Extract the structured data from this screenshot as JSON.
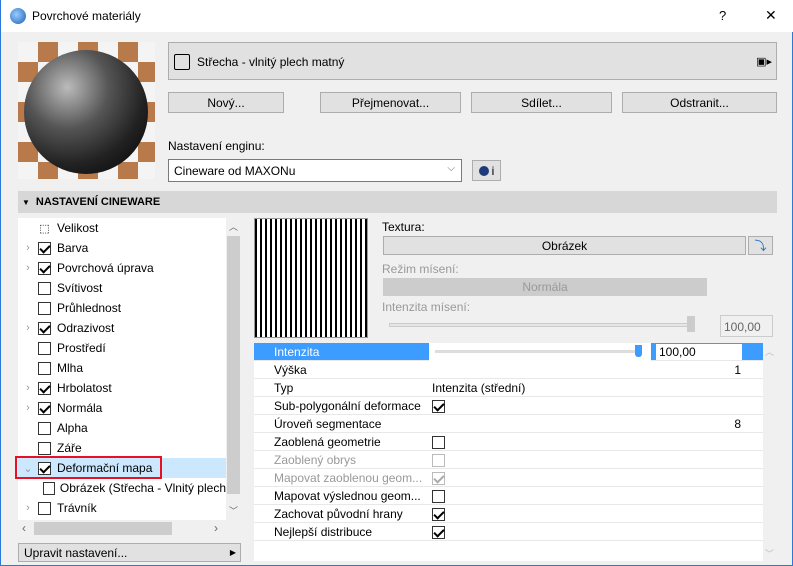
{
  "window": {
    "title": "Povrchové materiály",
    "help": "?",
    "close": "✕"
  },
  "material": {
    "name": "Střecha - vlnitý plech matný"
  },
  "buttons": {
    "new": "Nový...",
    "rename": "Přejmenovat...",
    "share": "Sdílet...",
    "delete": "Odstranit..."
  },
  "engine": {
    "label": "Nastavení enginu:",
    "value": "Cineware od MAXONu",
    "info": "i"
  },
  "section": {
    "title": "NASTAVENÍ CINEWARE"
  },
  "tree": [
    {
      "label": "Velikost",
      "expander": false,
      "checkbox": null
    },
    {
      "label": "Barva",
      "expander": true,
      "checked": true
    },
    {
      "label": "Povrchová úprava",
      "expander": true,
      "checked": true
    },
    {
      "label": "Svítivost",
      "expander": false,
      "checked": false
    },
    {
      "label": "Průhlednost",
      "expander": false,
      "checked": false
    },
    {
      "label": "Odrazivost",
      "expander": true,
      "checked": true
    },
    {
      "label": "Prostředí",
      "expander": false,
      "checked": false
    },
    {
      "label": "Mlha",
      "expander": false,
      "checked": false
    },
    {
      "label": "Hrbolatost",
      "expander": true,
      "checked": true
    },
    {
      "label": "Normála",
      "expander": true,
      "checked": true
    },
    {
      "label": "Alpha",
      "expander": false,
      "checked": false
    },
    {
      "label": "Záře",
      "expander": false,
      "checked": false
    },
    {
      "label": "Deformační mapa",
      "expander": true,
      "expanded": true,
      "checked": true,
      "selected": true
    },
    {
      "label": "Obrázek (Střecha - Vlnitý plech",
      "child": true
    },
    {
      "label": "Trávník",
      "expander": true,
      "checked": false
    }
  ],
  "edit_settings": "Upravit nastavení...",
  "texture": {
    "label": "Textura:",
    "value": "Obrázek",
    "blend_mode_label": "Režim mísení:",
    "blend_mode": "Normála",
    "blend_intensity_label": "Intenzita mísení:",
    "blend_intensity": "100,00",
    "blend_intensity_pct": 100
  },
  "props": [
    {
      "label": "Intenzita",
      "input": "100,00",
      "slider_pct": 100,
      "selected": true
    },
    {
      "label": "Výška",
      "num": "1"
    },
    {
      "label": "Typ",
      "text": "Intenzita (střední)"
    },
    {
      "label": "Sub-polygonální deformace",
      "check": true
    },
    {
      "label": "Úroveň segmentace",
      "num": "8"
    },
    {
      "label": "Zaoblená geometrie",
      "check": false
    },
    {
      "label": "Zaoblený obrys",
      "check": false,
      "disabled": true
    },
    {
      "label": "Mapovat zaoblenou geom...",
      "check": true,
      "disabled": true
    },
    {
      "label": "Mapovat výslednou geom...",
      "check": false
    },
    {
      "label": "Zachovat původní hrany",
      "check": true
    },
    {
      "label": "Nejlepší distribuce",
      "check": true
    }
  ],
  "colors": {
    "accent": "#3c9cff",
    "selection": "#cce8ff",
    "highlight": "#e81123"
  }
}
